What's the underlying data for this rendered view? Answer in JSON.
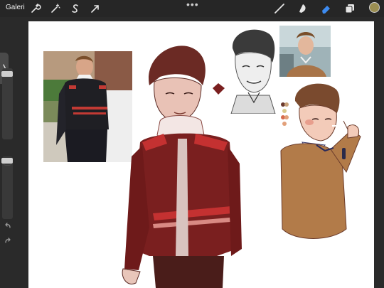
{
  "toolbar": {
    "gallery_label": "Galeri",
    "left_tools": [
      "wrench-icon",
      "magic-wand-icon",
      "selection-s-icon",
      "transform-arrow-icon"
    ],
    "more_label": "•••",
    "right_tools": [
      "brush-icon",
      "smudge-icon",
      "eraser-icon",
      "layers-icon"
    ],
    "active_tool": "eraser-icon",
    "current_color": "#9b8e52"
  },
  "sidebar": {
    "toggle_label": "❭"
  },
  "palette": [
    "#6b3a2e",
    "#c9a27a",
    "#d9c98c",
    "#d66b4d",
    "#e2a07a"
  ],
  "colors": {
    "jacket_dark": "#7a1f1f",
    "jacket_red": "#c43131",
    "skin": "#efc4b0",
    "sweater": "#b27b49",
    "hair": "#5a3a27",
    "accent_blue": "#3d8bf0"
  }
}
